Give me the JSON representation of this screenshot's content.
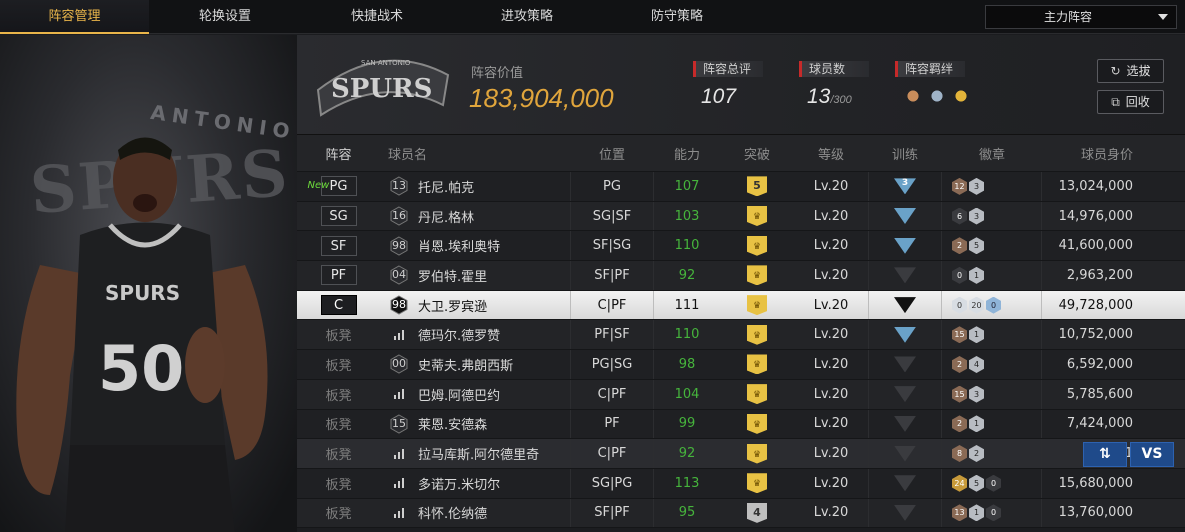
{
  "nav": {
    "tabs": [
      "阵容管理",
      "轮换设置",
      "快捷战术",
      "进攻策略",
      "防守策略"
    ],
    "active_tab": 0,
    "lineup_select": "主力阵容"
  },
  "hero": {
    "bg_logo_main": "SPURS",
    "bg_logo_sub": "ANTONIO",
    "jersey_team": "SPURS",
    "jersey_number": "50"
  },
  "header": {
    "team_logo_text": "SPURS",
    "team_logo_sub": "SAN ANTONIO",
    "value_label": "阵容价值",
    "value": "183,904,000",
    "overall_label": "阵容总评",
    "overall": "107",
    "players_label": "球员数",
    "players_count": "13",
    "players_max": "/300",
    "bonds_label": "阵容羁绊",
    "draft_button": "选拔",
    "return_button": "回收"
  },
  "table": {
    "columns": [
      "阵容",
      "球员名",
      "位置",
      "能力",
      "突破",
      "等级",
      "训练",
      "徽章",
      "球员身价"
    ],
    "rows": [
      {
        "role": "PG",
        "starter": true,
        "new": "New",
        "number": "13",
        "icon": "hex",
        "name": "托尼.帕克",
        "pos": "PG",
        "ability": "107",
        "green": true,
        "break": "5",
        "break_type": "num",
        "level": "Lv.20",
        "train": "3",
        "train_type": "blue",
        "badges": [
          [
            "12",
            "bronze"
          ],
          [
            "3",
            "silver"
          ]
        ],
        "value": "13,024,000"
      },
      {
        "role": "SG",
        "starter": true,
        "number": "16",
        "icon": "hex",
        "name": "丹尼.格林",
        "pos": "SG|SF",
        "ability": "103",
        "green": true,
        "break": "",
        "break_type": "crown",
        "level": "Lv.20",
        "train": "",
        "train_type": "blue",
        "badges": [
          [
            "6",
            "dark"
          ],
          [
            "3",
            "silver"
          ]
        ],
        "value": "14,976,000"
      },
      {
        "role": "SF",
        "starter": true,
        "number": "98",
        "icon": "hex",
        "name": "肖恩.埃利奥特",
        "pos": "SF|SG",
        "ability": "110",
        "green": true,
        "break": "",
        "break_type": "crown",
        "level": "Lv.20",
        "train": "",
        "train_type": "blue",
        "badges": [
          [
            "2",
            "bronze"
          ],
          [
            "5",
            "silver"
          ]
        ],
        "value": "41,600,000"
      },
      {
        "role": "PF",
        "starter": true,
        "number": "04",
        "icon": "hex",
        "name": "罗伯特.霍里",
        "pos": "SF|PF",
        "ability": "92",
        "green": true,
        "break": "",
        "break_type": "crown",
        "level": "Lv.20",
        "train": "",
        "train_type": "dark",
        "badges": [
          [
            "0",
            "dark"
          ],
          [
            "1",
            "silver"
          ]
        ],
        "value": "2,963,200"
      },
      {
        "role": "C",
        "starter": true,
        "highlight": true,
        "number": "98",
        "icon": "hex",
        "name": "大卫.罗宾逊",
        "pos": "C|PF",
        "ability": "111",
        "green": false,
        "break": "",
        "break_type": "crown",
        "level": "Lv.20",
        "train": "",
        "train_type": "black",
        "badges": [
          [
            "0",
            "pale"
          ],
          [
            "20",
            "pale"
          ],
          [
            "0",
            "blue"
          ]
        ],
        "value": "49,728,000"
      },
      {
        "role": "板凳",
        "starter": false,
        "number": "",
        "icon": "bars",
        "name": "德玛尔.德罗赞",
        "pos": "PF|SF",
        "ability": "110",
        "green": true,
        "break": "",
        "break_type": "crown",
        "level": "Lv.20",
        "train": "",
        "train_type": "blue",
        "badges": [
          [
            "15",
            "bronze"
          ],
          [
            "1",
            "silver"
          ]
        ],
        "value": "10,752,000"
      },
      {
        "role": "板凳",
        "starter": false,
        "number": "00",
        "icon": "hex",
        "name": "史蒂夫.弗朗西斯",
        "pos": "PG|SG",
        "ability": "98",
        "green": true,
        "break": "",
        "break_type": "crown",
        "level": "Lv.20",
        "train": "",
        "train_type": "dark",
        "badges": [
          [
            "2",
            "bronze"
          ],
          [
            "4",
            "silver"
          ]
        ],
        "value": "6,592,000"
      },
      {
        "role": "板凳",
        "starter": false,
        "number": "",
        "icon": "bars",
        "name": "巴姆.阿德巴约",
        "pos": "C|PF",
        "ability": "104",
        "green": true,
        "break": "",
        "break_type": "crown",
        "level": "Lv.20",
        "train": "",
        "train_type": "dark",
        "badges": [
          [
            "15",
            "bronze"
          ],
          [
            "3",
            "silver"
          ]
        ],
        "value": "5,785,600"
      },
      {
        "role": "板凳",
        "starter": false,
        "number": "15",
        "icon": "hex",
        "name": "莱恩.安德森",
        "pos": "PF",
        "ability": "99",
        "green": true,
        "break": "",
        "break_type": "crown",
        "level": "Lv.20",
        "train": "",
        "train_type": "dark",
        "badges": [
          [
            "2",
            "bronze"
          ],
          [
            "1",
            "silver"
          ]
        ],
        "value": "7,424,000"
      },
      {
        "role": "板凳",
        "starter": false,
        "hover": true,
        "number": "",
        "icon": "bars",
        "name": "拉马库斯.阿尔德里奇",
        "pos": "C|PF",
        "ability": "92",
        "green": true,
        "break": "",
        "break_type": "crown",
        "level": "Lv.20",
        "train": "",
        "train_type": "dark",
        "badges": [
          [
            "8",
            "bronze"
          ],
          [
            "2",
            "silver"
          ]
        ],
        "value": "1"
      },
      {
        "role": "板凳",
        "starter": false,
        "number": "",
        "icon": "bars",
        "name": "多诺万.米切尔",
        "pos": "SG|PG",
        "ability": "113",
        "green": true,
        "break": "",
        "break_type": "crown",
        "level": "Lv.20",
        "train": "",
        "train_type": "dark",
        "badges": [
          [
            "24",
            "gold"
          ],
          [
            "5",
            "silver"
          ],
          [
            "0",
            "dark"
          ]
        ],
        "value": "15,680,000"
      },
      {
        "role": "板凳",
        "starter": false,
        "number": "",
        "icon": "bars",
        "name": "科怀.伦纳德",
        "pos": "SF|PF",
        "ability": "95",
        "green": true,
        "break": "4",
        "break_type": "grey",
        "level": "Lv.20",
        "train": "",
        "train_type": "dark",
        "badges": [
          [
            "13",
            "bronze"
          ],
          [
            "1",
            "silver"
          ],
          [
            "0",
            "dark"
          ]
        ],
        "value": "13,760,000"
      }
    ]
  },
  "float": {
    "swap_icon": "swap-icon",
    "vs": "VS"
  },
  "colors": {
    "accent": "#e9b54a",
    "value": "#e0a53c",
    "green": "#46b43c",
    "red_marker": "#c62a2a",
    "vs_blue": "#1f4a8a"
  }
}
